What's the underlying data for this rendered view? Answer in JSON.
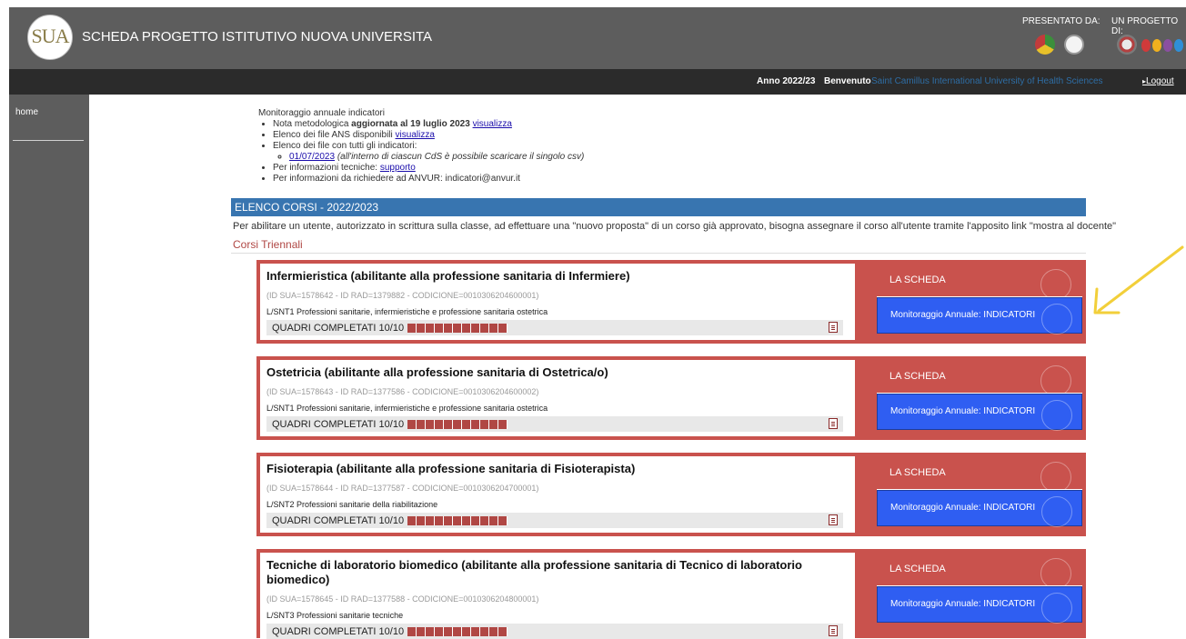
{
  "header": {
    "logo_text": "SUA",
    "title": "SCHEDA PROGETTO ISTITUTIVO NUOVA UNIVERSITA",
    "presented_by": "PRESENTATO DA:",
    "project_by": "UN PROGETTO DI:",
    "partner_badges": [
      "anvur-logo-icon",
      "cineca-logo-icon",
      "republic-emblem-icon",
      "miur-logo-icon"
    ]
  },
  "topbar": {
    "year": "Anno 2022/23",
    "welcome": "Benvenuto",
    "university": "Saint Camillus International University of Health Sciences",
    "logout": "Logout"
  },
  "sidebar": {
    "items": [
      {
        "label": "home"
      }
    ]
  },
  "notice": {
    "title": "Monitoraggio annuale indicatori",
    "nota_prefix": "Nota metodologica ",
    "nota_bold": "aggiornata al 19 luglio 2023",
    "nota_link": "visualizza",
    "ans_text": "Elenco dei file ANS disponibili ",
    "ans_link": "visualizza",
    "all_text": "Elenco dei file con tutti gli indicatori:",
    "date_link": "01/07/2023",
    "date_note": "(all'interno di ciascun CdS è possibile scaricare il singolo csv)",
    "tech_text": "Per informazioni tecniche: ",
    "tech_link": "supporto",
    "anvur_text": "Per informazioni da richiedere ad ANVUR: indicatori@anvur.it"
  },
  "section": {
    "title": "ELENCO CORSI - 2022/2023",
    "info": "Per abilitare un utente, autorizzato in scrittura sulla classe, ad effettuare una \"nuovo proposta\" di un corso già approvato, bisogna assegnare il corso all'utente tramite l'apposito link \"mostra al docente\"",
    "subsection": "Corsi Triennali"
  },
  "courses": [
    {
      "name": "Infermieristica (abilitante alla professione sanitaria di Infermiere)",
      "ids": "(ID SUA=1578642 - ID RAD=1379882 - CODICIONE=0010306204600001)",
      "class": "L/SNT1 Professioni sanitarie, infermieristiche e professione sanitaria ostetrica",
      "quadri": "QUADRI COMPLETATI 10/10",
      "progress": 1.0,
      "scheda_label": "LA SCHEDA",
      "mon_label": "Monitoraggio Annuale: INDICATORI"
    },
    {
      "name": "Ostetricia (abilitante alla professione sanitaria di Ostetrica/o)",
      "ids": "(ID SUA=1578643 - ID RAD=1377586 - CODICIONE=0010306204600002)",
      "class": "L/SNT1 Professioni sanitarie, infermieristiche e professione sanitaria ostetrica",
      "quadri": "QUADRI COMPLETATI 10/10",
      "progress": 1.0,
      "scheda_label": "LA SCHEDA",
      "mon_label": "Monitoraggio Annuale: INDICATORI"
    },
    {
      "name": "Fisioterapia (abilitante alla professione sanitaria di Fisioterapista)",
      "ids": "(ID SUA=1578644 - ID RAD=1377587 - CODICIONE=0010306204700001)",
      "class": "L/SNT2 Professioni sanitarie della riabilitazione",
      "quadri": "QUADRI COMPLETATI 10/10",
      "progress": 1.0,
      "scheda_label": "LA SCHEDA",
      "mon_label": "Monitoraggio Annuale: INDICATORI"
    },
    {
      "name": "Tecniche di laboratorio biomedico (abilitante alla professione sanitaria di Tecnico di laboratorio biomedico)",
      "ids": "(ID SUA=1578645 - ID RAD=1377588 - CODICIONE=0010306204800001)",
      "class": "L/SNT3 Professioni sanitarie tecniche",
      "quadri": "QUADRI COMPLETATI 10/10",
      "progress": 1.0,
      "scheda_label": "LA SCHEDA",
      "mon_label": "Monitoraggio Annuale: INDICATORI"
    }
  ],
  "annotation": {
    "arrow_color": "#f2cf3a"
  },
  "colors": {
    "header_gray": "#5d5d5d",
    "accent_blue": "#3875b0",
    "course_red": "#c9524d",
    "button_blue": "#2f5ef2"
  }
}
